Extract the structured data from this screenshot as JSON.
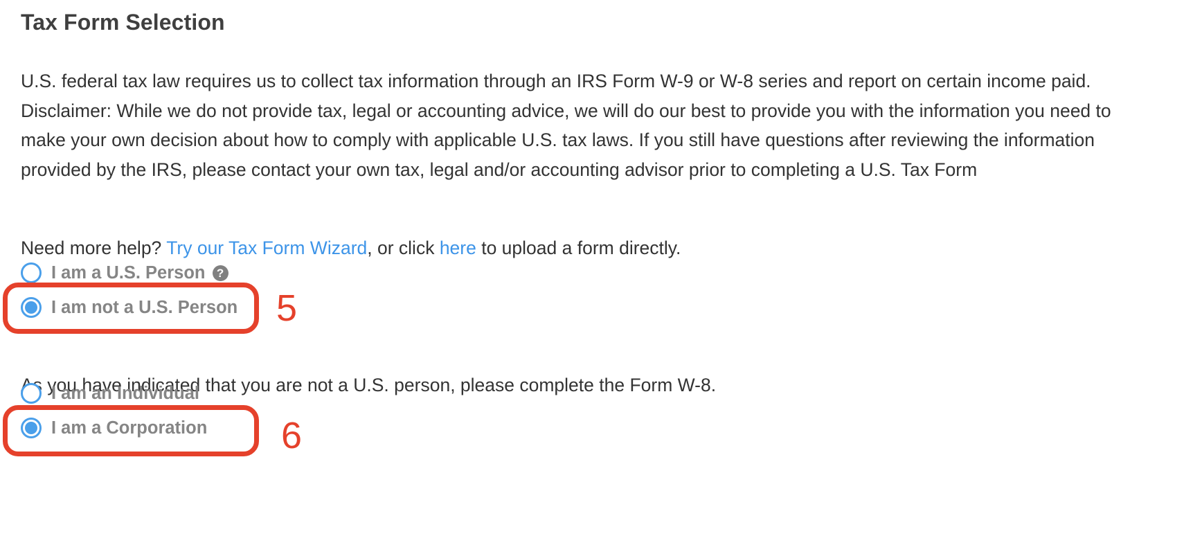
{
  "header": {
    "title": "Tax Form Selection"
  },
  "disclaimer": "U.S. federal tax law requires us to collect tax information through an IRS Form W-9 or W-8 series and report on certain income paid. Disclaimer: While we do not provide tax, legal or accounting advice, we will do our best to provide you with the information you need to make your own decision about how to comply with applicable U.S. tax laws. If you still have questions after reviewing the information provided by the IRS, please contact your own tax, legal and/or accounting advisor prior to completing a U.S. Tax Form",
  "help": {
    "prefix": "Need more help? ",
    "wizard_link": "Try our Tax Form Wizard",
    "middle": ", or click ",
    "here_link": "here",
    "suffix": " to upload a form directly."
  },
  "person_options": [
    {
      "label": "I am a U.S. Person",
      "checked": false,
      "help_icon": "question-circle-icon"
    },
    {
      "label": "I am not a U.S. Person",
      "checked": true
    }
  ],
  "info_text": "As you have indicated that you are not a U.S. person, please complete the Form W-8.",
  "entity_options": [
    {
      "label": "I am an Individual",
      "checked": false
    },
    {
      "label": "I am a Corporation",
      "checked": true
    }
  ],
  "annotations": [
    {
      "number": "5"
    },
    {
      "number": "6"
    }
  ],
  "colors": {
    "accent": "#4a9fea",
    "link": "#3d94e8",
    "annotation": "#e5412b",
    "label": "#858585"
  }
}
